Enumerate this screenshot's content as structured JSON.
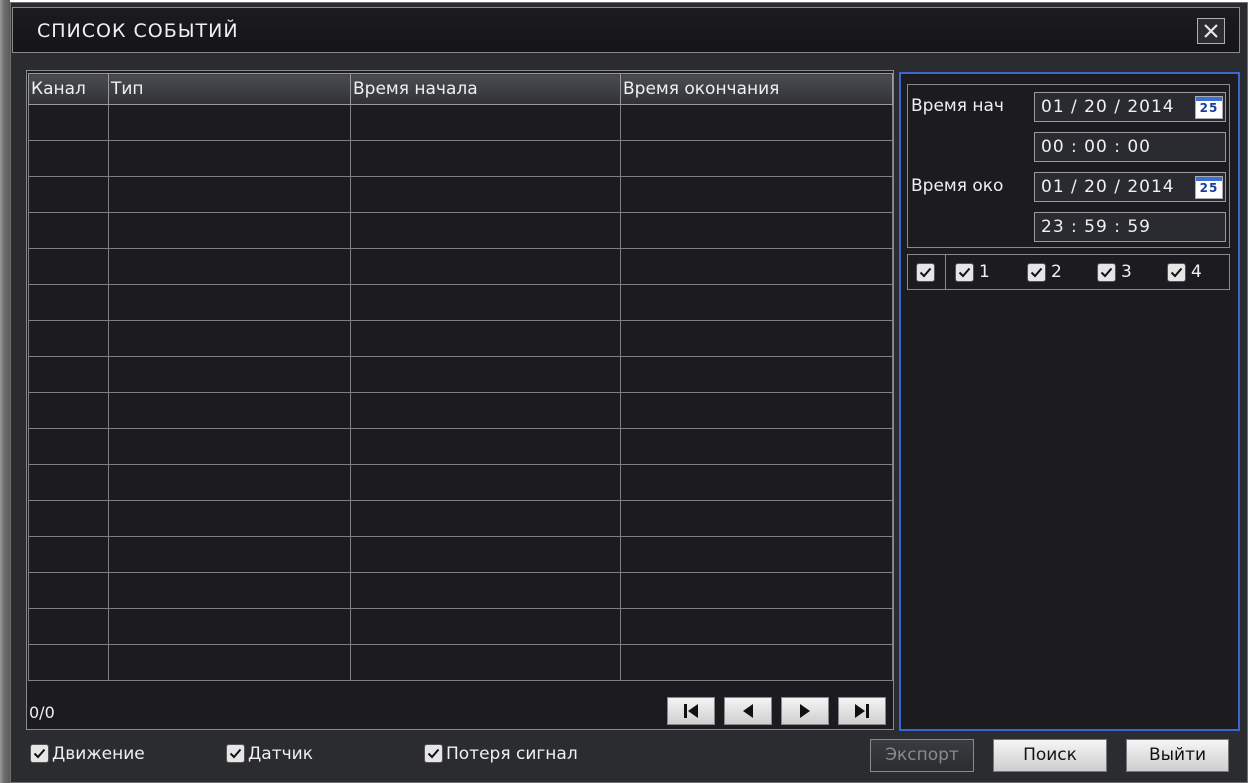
{
  "window": {
    "title": "СПИСОК СОБЫТИЙ"
  },
  "table": {
    "columns": [
      "Канал",
      "Тип",
      "Время начала",
      "Время окончания"
    ],
    "rows": []
  },
  "pagination": {
    "counter": "0/0"
  },
  "filter": {
    "start_label": "Время нач",
    "start_date": "01 / 20 / 2014",
    "start_time": "00 : 00 : 00",
    "end_label": "Время око",
    "end_date": "01 / 20 / 2014",
    "end_time": "23 : 59 : 59",
    "calendar_icon_text": "25",
    "channels": [
      "1",
      "2",
      "3",
      "4"
    ]
  },
  "event_types": [
    "Движение",
    "Датчик",
    "Потеря сигнал"
  ],
  "buttons": {
    "export": "Экспорт",
    "search": "Поиск",
    "exit": "Выйти"
  },
  "colors": {
    "accent_border": "#3a66d0",
    "background": "#1c1c20"
  }
}
